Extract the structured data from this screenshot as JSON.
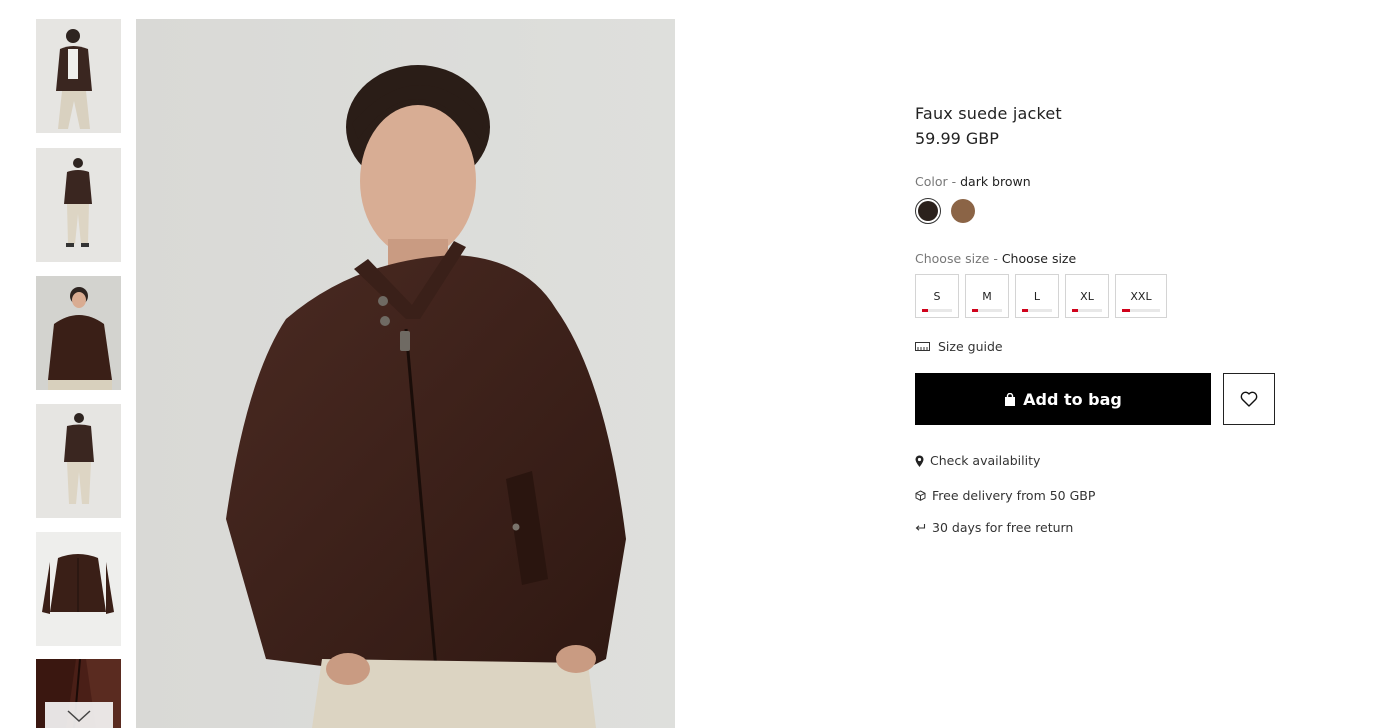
{
  "product": {
    "title": "Faux suede jacket",
    "price": "59.99 GBP"
  },
  "color": {
    "label": "Color",
    "separator": " - ",
    "selected_name": "dark brown",
    "swatches": [
      {
        "name": "dark brown",
        "hex": "#2b211c"
      },
      {
        "name": "brown",
        "hex": "#8b6446"
      }
    ]
  },
  "size": {
    "label": "Choose size",
    "separator": " - ",
    "selected_text": "Choose size",
    "options": [
      {
        "label": "S",
        "stock_level": 0.2
      },
      {
        "label": "M",
        "stock_level": 0.2
      },
      {
        "label": "L",
        "stock_level": 0.2
      },
      {
        "label": "XL",
        "stock_level": 0.2
      },
      {
        "label": "XXL",
        "stock_level": 0.2
      }
    ],
    "stock_color": "#d0021b"
  },
  "size_guide": {
    "label": "Size guide",
    "icon": "ruler-icon"
  },
  "actions": {
    "add_to_bag": "Add to bag",
    "add_icon": "shopping-bag-icon",
    "wishlist_icon": "heart-icon"
  },
  "info": {
    "availability": "Check availability",
    "delivery": "Free delivery from 50 GBP",
    "returns": "30 days for free return"
  },
  "gallery": {
    "thumbnail_count": 6,
    "active_index": 2,
    "next_icon": "chevron-down-icon"
  }
}
